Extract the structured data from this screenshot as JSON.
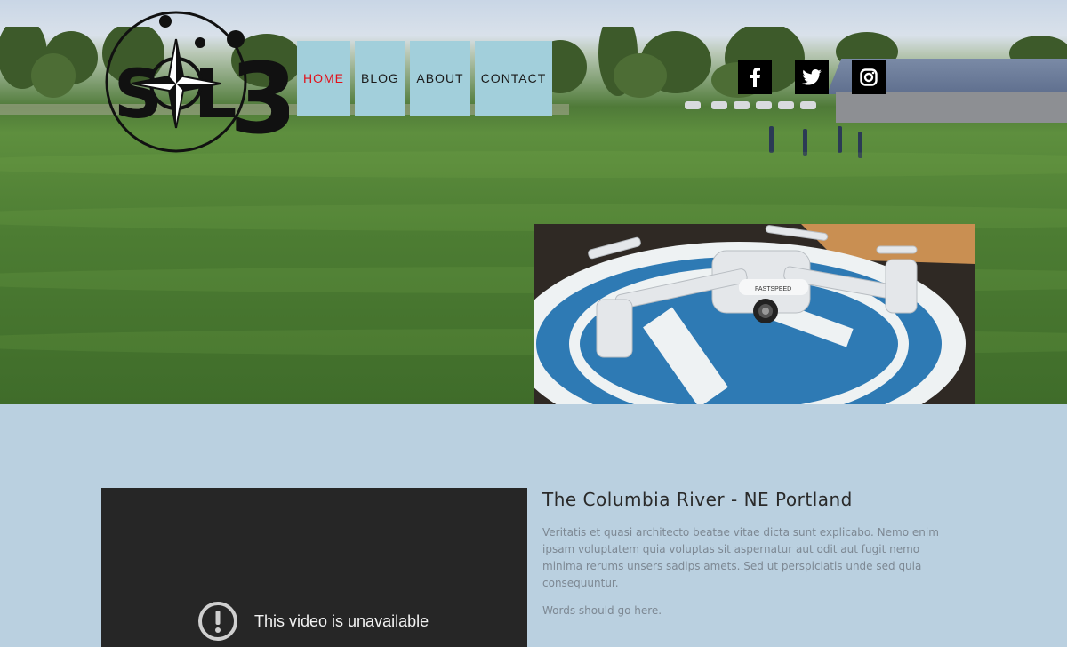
{
  "header": {
    "logo_text": "SOL3",
    "nav": [
      {
        "label": "HOME",
        "active": true
      },
      {
        "label": "BLOG",
        "active": false
      },
      {
        "label": "ABOUT",
        "active": false
      },
      {
        "label": "CONTACT",
        "active": false
      }
    ],
    "social": [
      {
        "icon": "facebook-icon"
      },
      {
        "icon": "twitter-icon"
      },
      {
        "icon": "instagram-icon"
      }
    ]
  },
  "hero": {
    "background": "park-field-photo",
    "inset_image": "drone-on-landing-pad-photo",
    "drone_brand_text": "FASTSPEED"
  },
  "content": {
    "video": {
      "message": "This video is unavailable",
      "icon": "exclamation-circle-icon"
    },
    "article": {
      "title": "The Columbia River - NE Portland",
      "paragraph1": "Veritatis et quasi architecto beatae vitae dicta sunt explicabo. Nemo enim ipsam voluptatem quia voluptas sit aspernatur aut odit aut fugit nemo minima rerums unsers sadips amets. Sed ut perspiciatis unde sed quia consequuntur.",
      "paragraph2": "Words should go here."
    }
  },
  "colors": {
    "nav_bg": "#a2cfdb",
    "nav_active": "#e2101a",
    "page_bg": "#bad0e0",
    "video_bg": "#262626"
  }
}
